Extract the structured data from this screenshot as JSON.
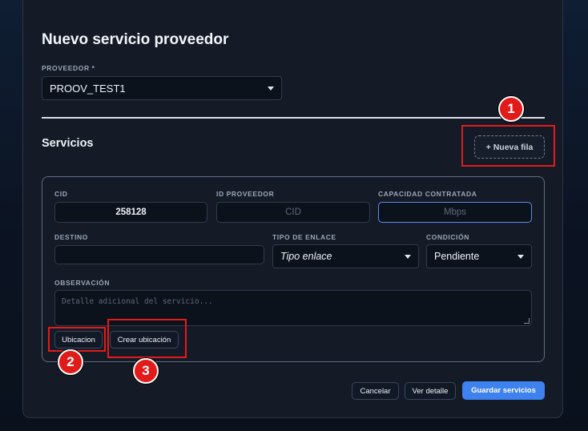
{
  "dialog": {
    "title": "Nuevo servicio proveedor",
    "provider_label": "PROVEEDOR *",
    "provider_value": "PROOV_TEST1"
  },
  "services": {
    "title": "Servicios",
    "new_row_label": "+ Nueva fila",
    "row": {
      "cid_label": "CID",
      "cid_value": "258128",
      "provider_id_label": "ID PROVEEDOR",
      "provider_id_placeholder": "CID",
      "capacity_label": "CAPACIDAD CONTRATADA",
      "capacity_placeholder": "Mbps",
      "destination_label": "DESTINO",
      "destination_value": "",
      "link_type_label": "TIPO DE ENLACE",
      "link_type_value": "Tipo enlace",
      "condition_label": "CONDICIÓN",
      "condition_value": "Pendiente",
      "observation_label": "OBSERVACIÓN",
      "observation_placeholder": "Detalle adicional del servicio...",
      "location_button": "Ubicacion",
      "create_location_button": "Crear ubicación"
    }
  },
  "footer": {
    "cancel": "Cancelar",
    "view_detail": "Ver detalle",
    "save": "Guardar servicios"
  },
  "annotations": {
    "marker_1": "1",
    "marker_2": "2",
    "marker_3": "3",
    "color": "#e21b1b"
  },
  "colors": {
    "accent": "#3d82ee",
    "background": "#141b27"
  }
}
